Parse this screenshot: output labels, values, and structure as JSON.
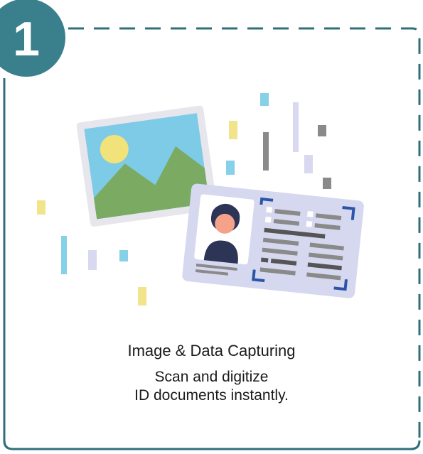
{
  "step": {
    "number": "1"
  },
  "caption": {
    "title": "Image & Data Capturing",
    "line1": "Scan and digitize",
    "line2": "ID documents instantly."
  },
  "colors": {
    "badge": "#3a7f8c",
    "frame_border": "#2f6f7c",
    "photo_sky": "#7ecbe8",
    "photo_sun": "#f2e27a",
    "photo_hills": "#7bab62",
    "id_card": "#d6d8ef",
    "id_corner": "#2c55a8",
    "accent_blue": "#86d0e8",
    "accent_yellow": "#f1e48a",
    "accent_lavender": "#d8d8f0",
    "accent_gray": "#8a8a8a"
  },
  "icons": {
    "photo": "landscape-photo-icon",
    "id_card": "id-card-icon",
    "avatar": "person-avatar-icon"
  }
}
